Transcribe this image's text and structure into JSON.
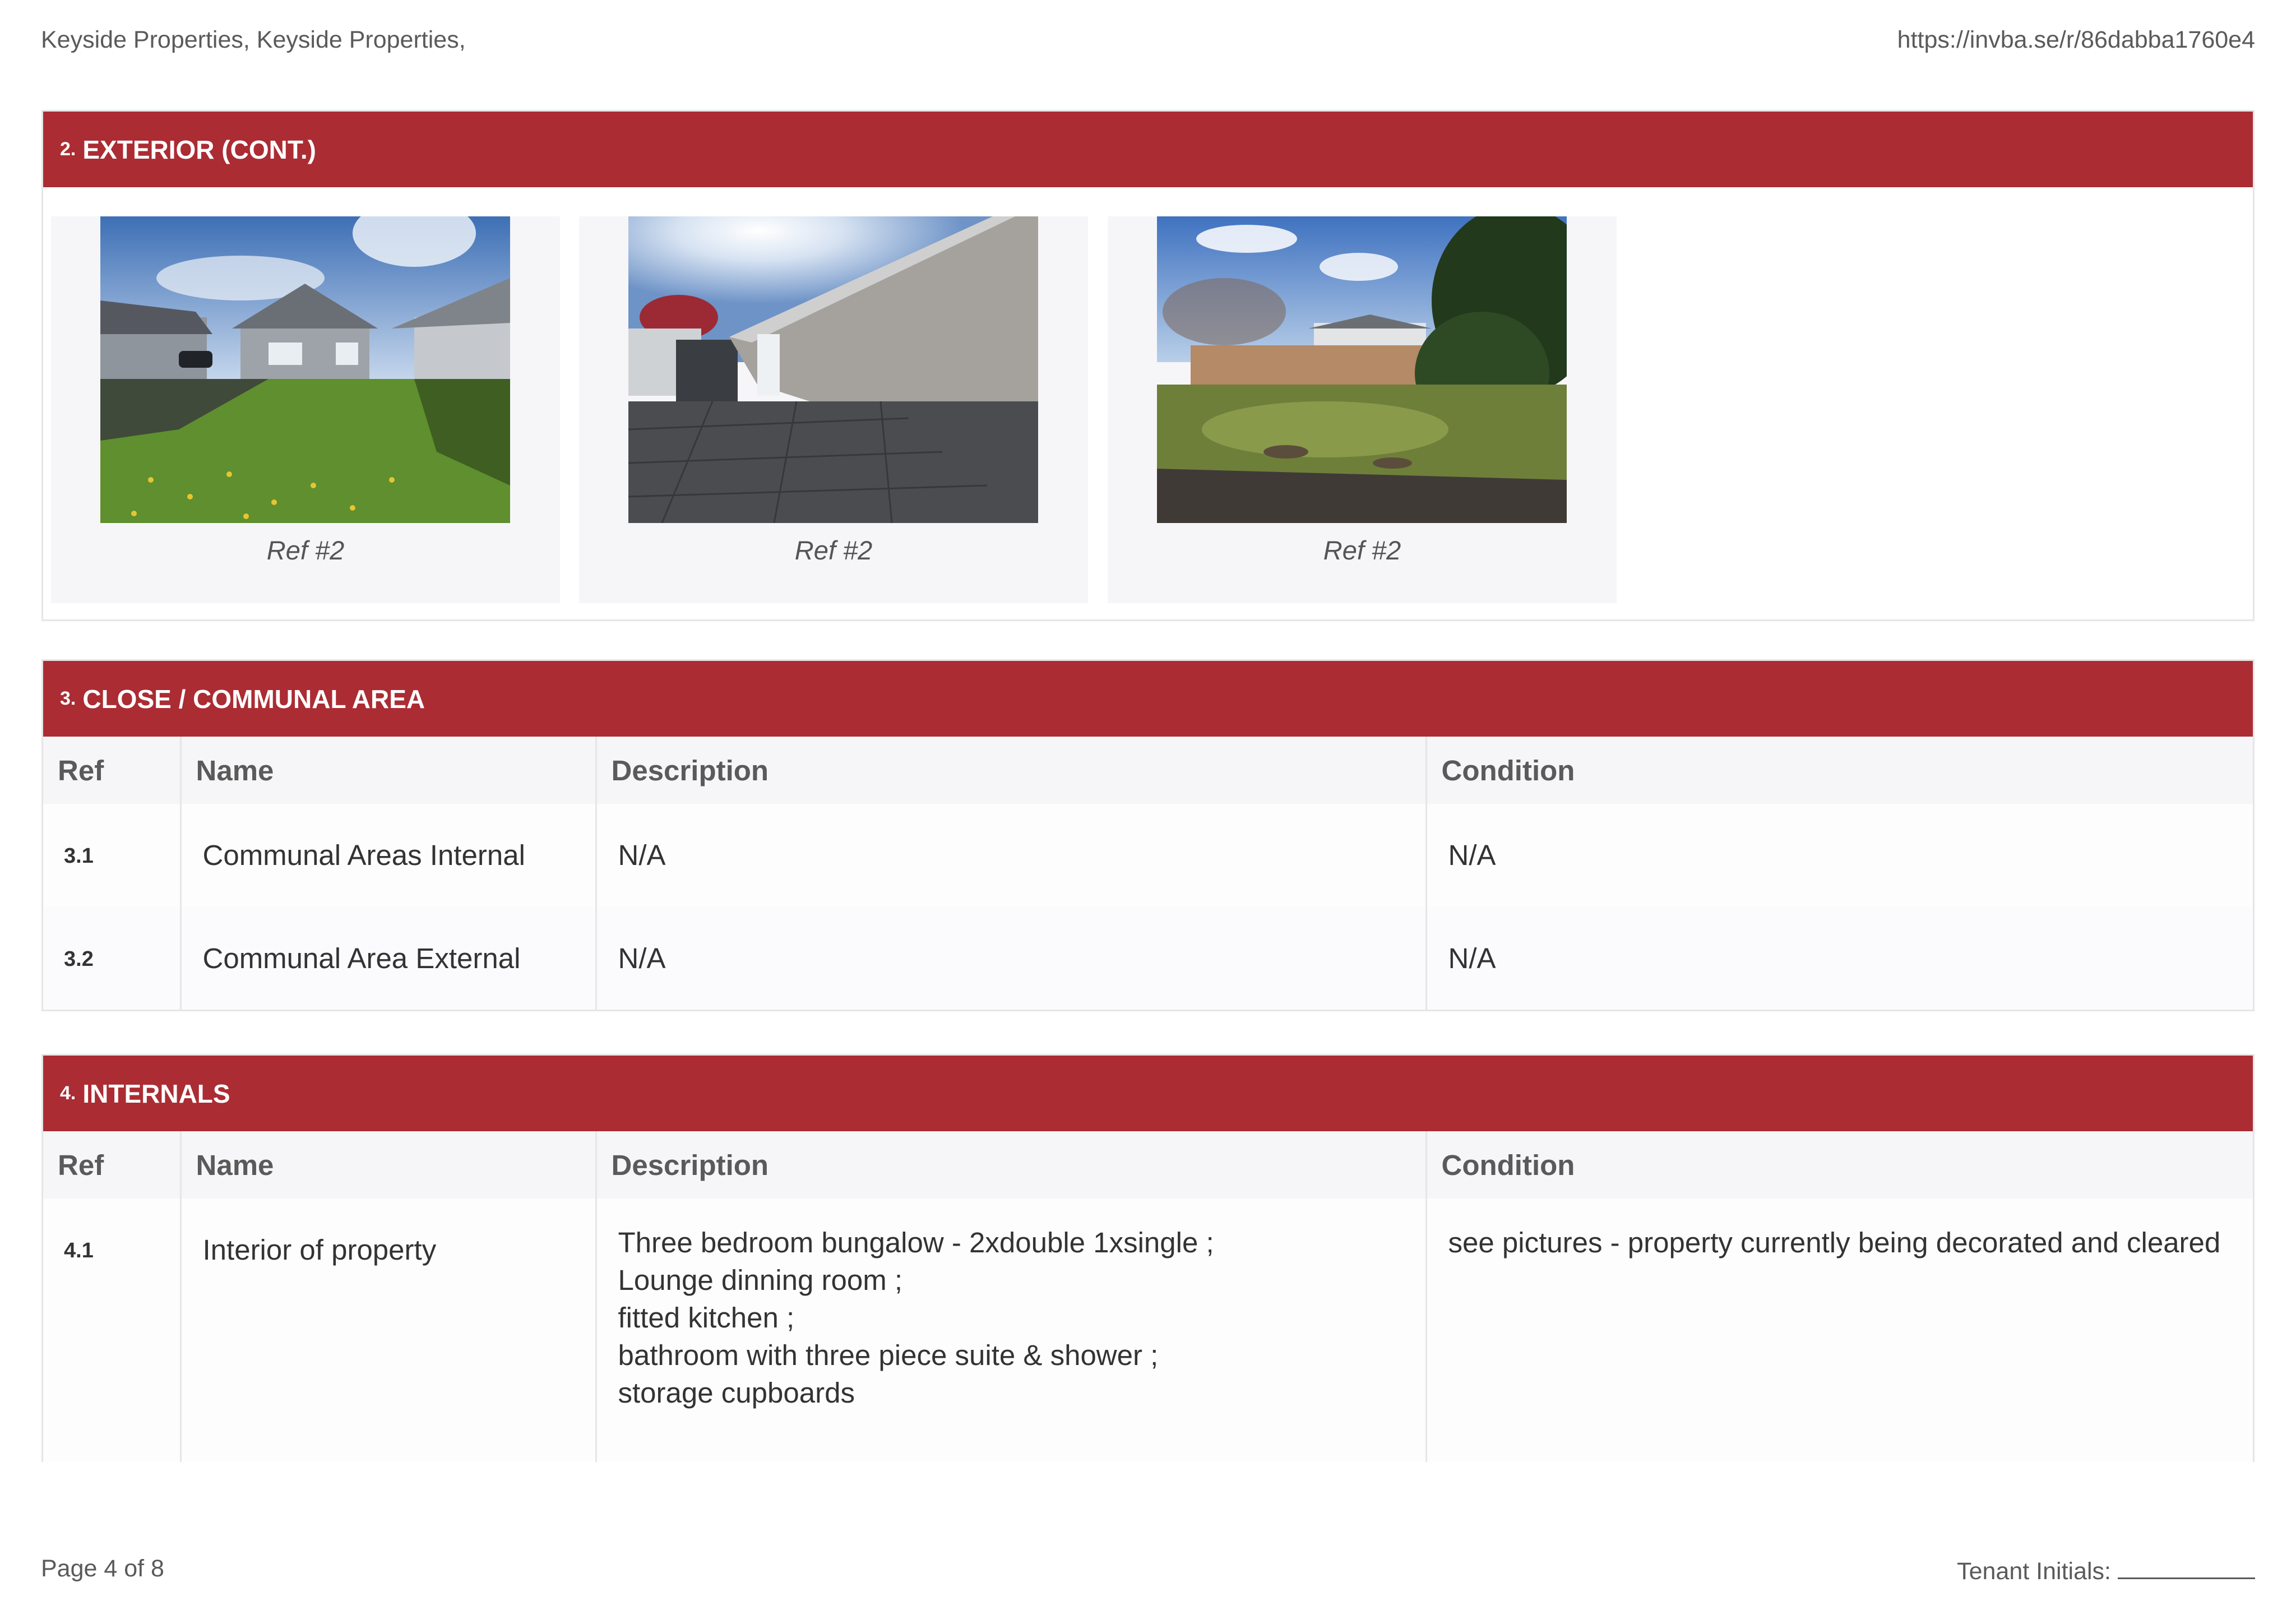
{
  "header": {
    "left": "Keyside Properties, Keyside Properties,",
    "right": "https://invba.se/r/86dabba1760e4"
  },
  "exterior": {
    "num": "2.",
    "title": "EXTERIOR (CONT.)",
    "photos": [
      {
        "caption": "Ref #2"
      },
      {
        "caption": "Ref #2"
      },
      {
        "caption": "Ref #2"
      }
    ]
  },
  "communal": {
    "num": "3.",
    "title": "CLOSE / COMMUNAL AREA",
    "columns": [
      "Ref",
      "Name",
      "Description",
      "Condition"
    ],
    "rows": [
      {
        "ref": "3.1",
        "name": "Communal Areas Internal",
        "description": "N/A",
        "condition": "N/A"
      },
      {
        "ref": "3.2",
        "name": "Communal Area External",
        "description": "N/A",
        "condition": "N/A"
      }
    ]
  },
  "internals": {
    "num": "4.",
    "title": "INTERNALS",
    "columns": [
      "Ref",
      "Name",
      "Description",
      "Condition"
    ],
    "rows": [
      {
        "ref": "4.1",
        "name": "Interior of property",
        "description_lines": [
          "Three bedroom bungalow - 2xdouble 1xsingle ;",
          "Lounge dinning room ;",
          "fitted kitchen ;",
          "bathroom with three piece suite & shower ;",
          "storage cupboards"
        ],
        "condition": "see pictures - property currently being decorated and cleared"
      }
    ]
  },
  "footer": {
    "page": "Page 4 of 8",
    "initials_label": "Tenant Initials:"
  }
}
